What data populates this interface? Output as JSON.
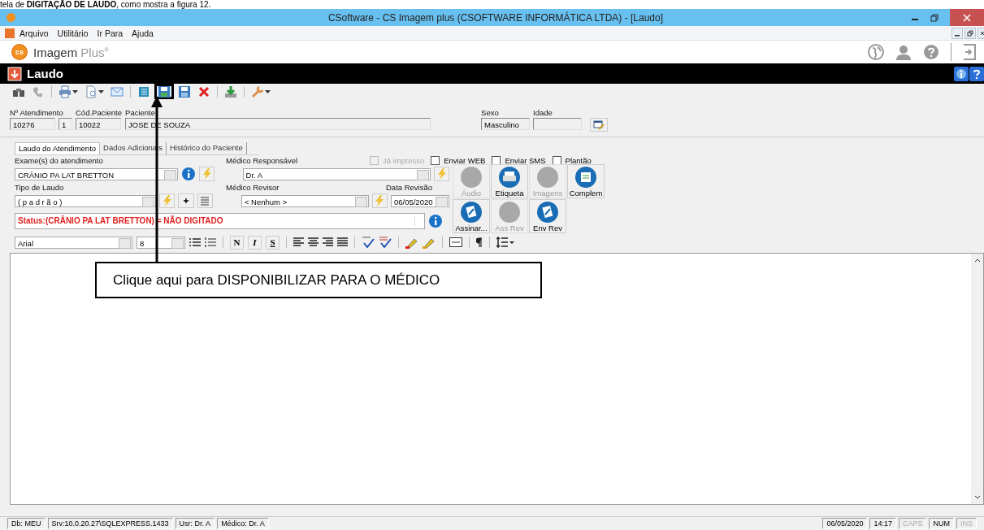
{
  "caption": "tela de **DIGITAÇÃO DE LAUDO**, como mostra a figura 12.",
  "window": {
    "title": "CSoftware - CS Imagem plus (CSOFTWARE INFORMÁTICA LTDA) - [Laudo]"
  },
  "menu": [
    {
      "label": "Arquivo"
    },
    {
      "label": "Utilitário"
    },
    {
      "label": "Ir Para"
    },
    {
      "label": "Ajuda"
    }
  ],
  "brand": {
    "logo": "cs",
    "name": "Imagem",
    "suffix": "Plus",
    "mark": "®"
  },
  "form_title": "Laudo",
  "toolbar": [
    [
      {
        "kind": "binoculars",
        "highlighted": false
      },
      {
        "kind": "phone",
        "highlighted": false
      }
    ],
    [
      {
        "kind": "print",
        "highlighted": false
      },
      {
        "kind": "document",
        "highlighted": false
      },
      {
        "kind": "mail",
        "highlighted": false
      }
    ],
    [
      {
        "kind": "list",
        "highlighted": false
      },
      {
        "kind": "save-green",
        "highlighted": true
      },
      {
        "kind": "save",
        "highlighted": false
      },
      {
        "kind": "delete",
        "highlighted": false
      }
    ],
    [
      {
        "kind": "download",
        "highlighted": false
      }
    ],
    [
      {
        "kind": "tools",
        "highlighted": false
      }
    ]
  ],
  "patient": {
    "atendimento": {
      "label": "Nº Atendimento",
      "value": "10276",
      "seq": "1"
    },
    "codigo": {
      "label": "Cód.Paciente",
      "value": "10022"
    },
    "nome": {
      "label": "Paciente",
      "value": "JOSE DE SOUZA"
    },
    "sexo": {
      "label": "Sexo",
      "value": "Masculino"
    },
    "idade": {
      "label": "Idade"
    }
  },
  "tabs": [
    {
      "label": "Laudo do Atendimento",
      "selected": true
    },
    {
      "label": "Dados Adicionais",
      "selected": false
    },
    {
      "label": "Histórico do Paciente",
      "selected": false
    }
  ],
  "checkboxes": [
    {
      "label": "Já impresso",
      "checked": false,
      "disabled": true
    },
    {
      "label": "Enviar WEB",
      "checked": false,
      "disabled": false
    },
    {
      "label": "Enviar SMS",
      "checked": false,
      "disabled": false
    },
    {
      "label": "Plantão",
      "checked": false,
      "disabled": false
    }
  ],
  "exame": {
    "label": "Exame(s) do atendimento",
    "value": "CRÂNIO PA LAT BRETTON"
  },
  "medico": {
    "label": "Médico Responsável",
    "value": "Dr. A"
  },
  "tipo": {
    "label": "Tipo de Laudo",
    "value": "( p a d r ã o )"
  },
  "revisor": {
    "label": "Médico Revisor",
    "value": "< Nenhum >"
  },
  "data_revisao": {
    "label": "Data Revisão",
    "value": "06/05/2020"
  },
  "status_line": "Status:(CRÂNIO PA LAT BRETTON) = NÃO DIGITADO",
  "actions": [
    {
      "label": "Áudio",
      "kind": "audio",
      "disabled": true
    },
    {
      "label": "Etiqueta",
      "kind": "label",
      "disabled": false
    },
    {
      "label": "Imagens",
      "kind": "images",
      "disabled": true
    },
    {
      "label": "Complem",
      "kind": "complement",
      "disabled": false
    },
    {
      "label": "Assinar...",
      "kind": "sign",
      "disabled": false
    },
    {
      "label": "Ass Rev",
      "kind": "sign-review",
      "disabled": true
    },
    {
      "label": "Env Rev",
      "kind": "send-review",
      "disabled": false
    }
  ],
  "format": {
    "font": "Arial",
    "size": "8",
    "bold": "N",
    "italic": "I",
    "strike": "S"
  },
  "annotation": "Clique aqui para DISPONIBILIZAR PARA O MÉDICO",
  "status_bar": [
    {
      "text": "Db: MEU",
      "disabled": false
    },
    {
      "text": "Srv:10.0.20.27\\SQLEXPRESS.1433",
      "disabled": false
    },
    {
      "text": "Usr: Dr. A",
      "disabled": false
    },
    {
      "text": "Médico: Dr. A",
      "disabled": false
    }
  ],
  "status_bar_right": [
    {
      "text": "06/05/2020",
      "disabled": false
    },
    {
      "text": "14:17",
      "disabled": false
    },
    {
      "text": "CAPS",
      "disabled": true
    },
    {
      "text": "NUM",
      "disabled": false
    },
    {
      "text": "INS",
      "disabled": true
    }
  ]
}
